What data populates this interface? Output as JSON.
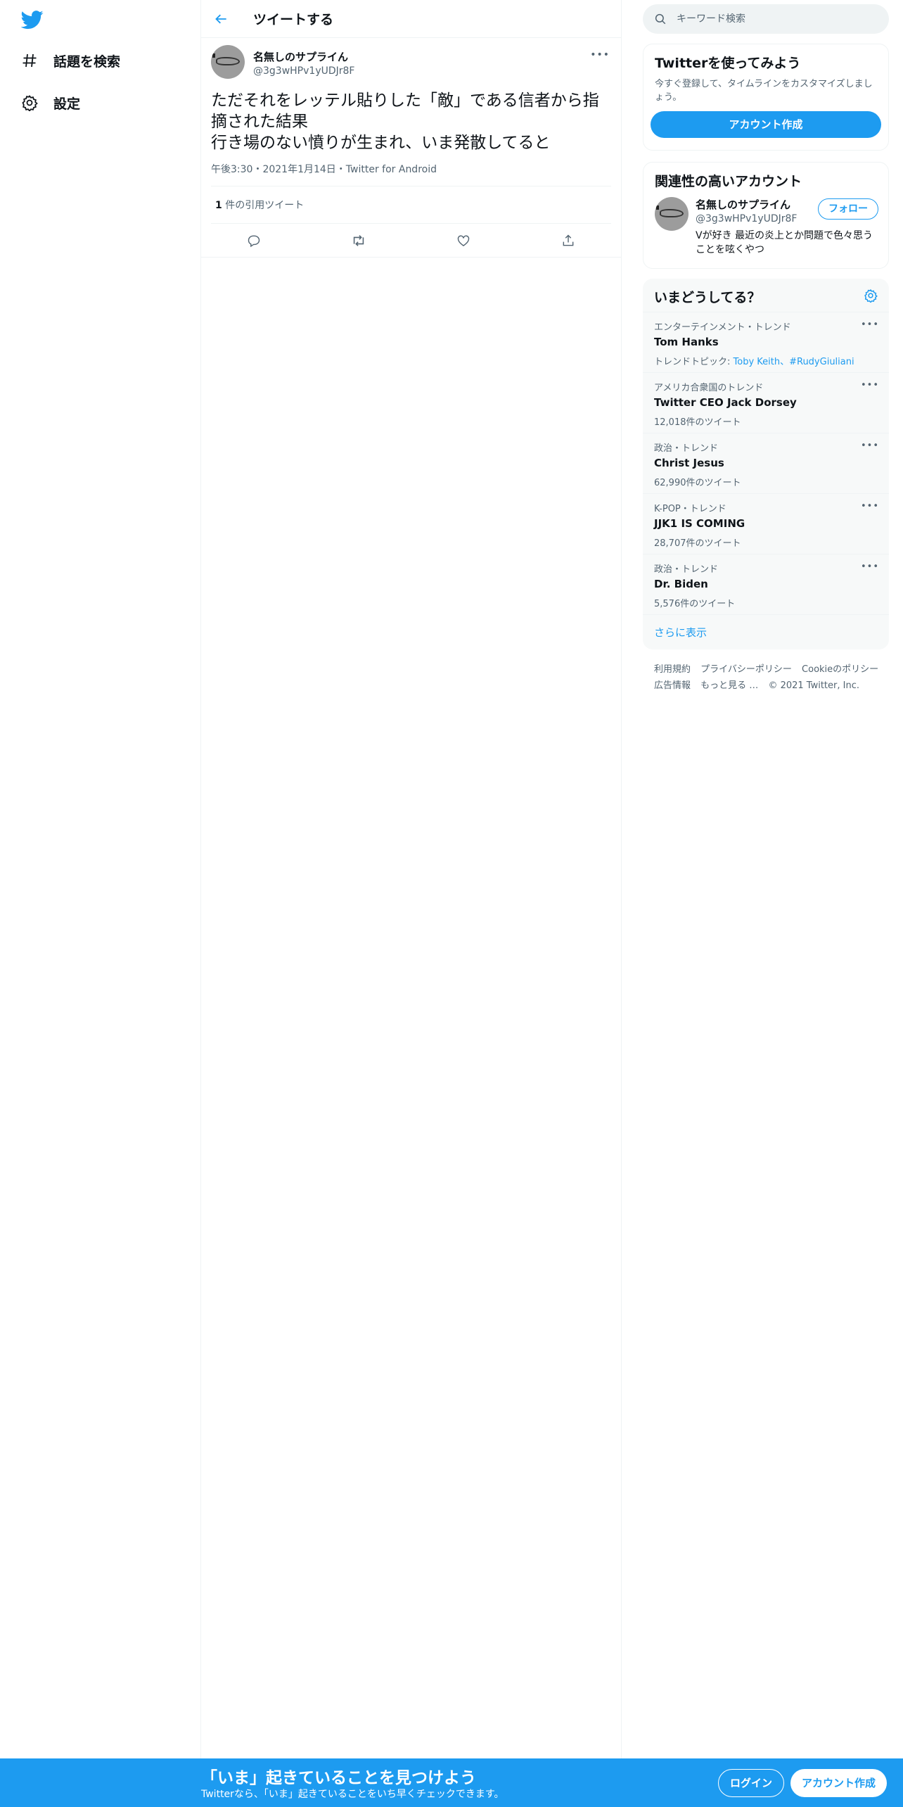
{
  "app": {
    "logo_icon": "twitter-bird-icon",
    "brand_color": "#1d9bf0"
  },
  "leftnav": {
    "items": [
      {
        "label": "話題を検索",
        "icon": "hashtag-icon"
      },
      {
        "label": "設定",
        "icon": "gear-icon"
      }
    ]
  },
  "main": {
    "header_title": "ツイートする",
    "tweet": {
      "name": "名無しのサプライん",
      "handle": "@3g3wHPv1yUDJr8F",
      "text": "ただそれをレッテル貼りした「敵」である信者から指摘された結果\n行き場のない憤りが生まれ、いま発散してると",
      "meta": "午後3:30・2021年1月14日・Twitter for Android",
      "quote_count": "1",
      "quote_label": " 件の引用ツイート"
    }
  },
  "right": {
    "search_placeholder": "キーワード検索",
    "signup": {
      "title": "Twitterを使ってみよう",
      "desc": "今すぐ登録して、タイムラインをカスタマイズしましょう。",
      "button": "アカウント作成"
    },
    "related": {
      "title": "関連性の高いアカウント",
      "name": "名無しのサプライん",
      "handle": "@3g3wHPv1yUDJr8F",
      "bio": "Vが好き 最近の炎上とか問題で色々思うことを呟くやつ",
      "follow": "フォロー"
    },
    "trends": {
      "title": "いまどうしてる？",
      "items": [
        {
          "category": "エンターテインメント・トレンド",
          "name": "Tom Hanks",
          "sub_prefix": "トレンドトピック: ",
          "sub_links": "Toby Keith、#RudyGiuliani",
          "sub": ""
        },
        {
          "category": "アメリカ合衆国のトレンド",
          "name": "Twitter CEO Jack Dorsey",
          "sub_prefix": "",
          "sub_links": "",
          "sub": "12,018件のツイート"
        },
        {
          "category": "政治・トレンド",
          "name": "Christ Jesus",
          "sub_prefix": "",
          "sub_links": "",
          "sub": "62,990件のツイート"
        },
        {
          "category": "K-POP・トレンド",
          "name": "JJK1 IS COMING",
          "sub_prefix": "",
          "sub_links": "",
          "sub": "28,707件のツイート"
        },
        {
          "category": "政治・トレンド",
          "name": "Dr. Biden",
          "sub_prefix": "",
          "sub_links": "",
          "sub": "5,576件のツイート"
        }
      ],
      "show_more": "さらに表示"
    },
    "footer": {
      "links": [
        "利用規約",
        "プライバシーポリシー",
        "Cookieのポリシー",
        "広告情報",
        "もっと見る …"
      ],
      "copyright": "© 2021 Twitter, Inc."
    }
  },
  "bottombar": {
    "title": "「いま」起きていることを見つけよう",
    "subtitle": "Twitterなら、「いま」起きていることをいち早くチェックできます。",
    "login": "ログイン",
    "signup": "アカウント作成"
  }
}
